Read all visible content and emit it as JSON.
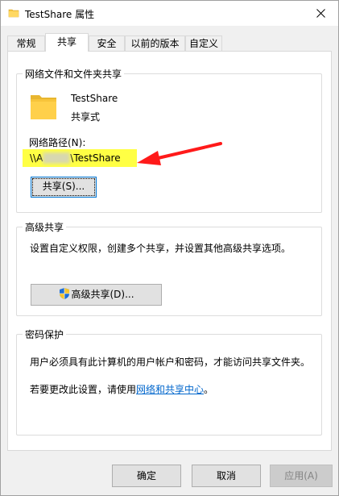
{
  "window": {
    "title": "TestShare 属性"
  },
  "tabs": [
    {
      "label": "常规",
      "active": false
    },
    {
      "label": "共享",
      "active": true
    },
    {
      "label": "安全",
      "active": false
    },
    {
      "label": "以前的版本",
      "active": false
    },
    {
      "label": "自定义",
      "active": false
    }
  ],
  "network_share": {
    "group_title": "网络文件和文件夹共享",
    "name": "TestShare",
    "type": "共享式",
    "path_label": "网络路径(N):",
    "path_prefix": "\\\\A",
    "path_suffix": "\\TestShare",
    "share_button": "共享(S)..."
  },
  "advanced_share": {
    "group_title": "高级共享",
    "description": "设置自定义权限，创建多个共享，并设置其他高级共享选项。",
    "button": "高级共享(D)..."
  },
  "password_protection": {
    "group_title": "密码保护",
    "description": "用户必须具有此计算机的用户帐户和密码，才能访问共享文件夹。",
    "change_prefix": "若要更改此设置，请使用",
    "change_link": "网络和共享中心",
    "change_suffix": "。"
  },
  "footer": {
    "ok": "确定",
    "cancel": "取消",
    "apply": "应用(A)"
  },
  "colors": {
    "highlight": "#ffff44",
    "arrow": "#ff0000",
    "link": "#0066cc",
    "folder": "#f5c542"
  }
}
